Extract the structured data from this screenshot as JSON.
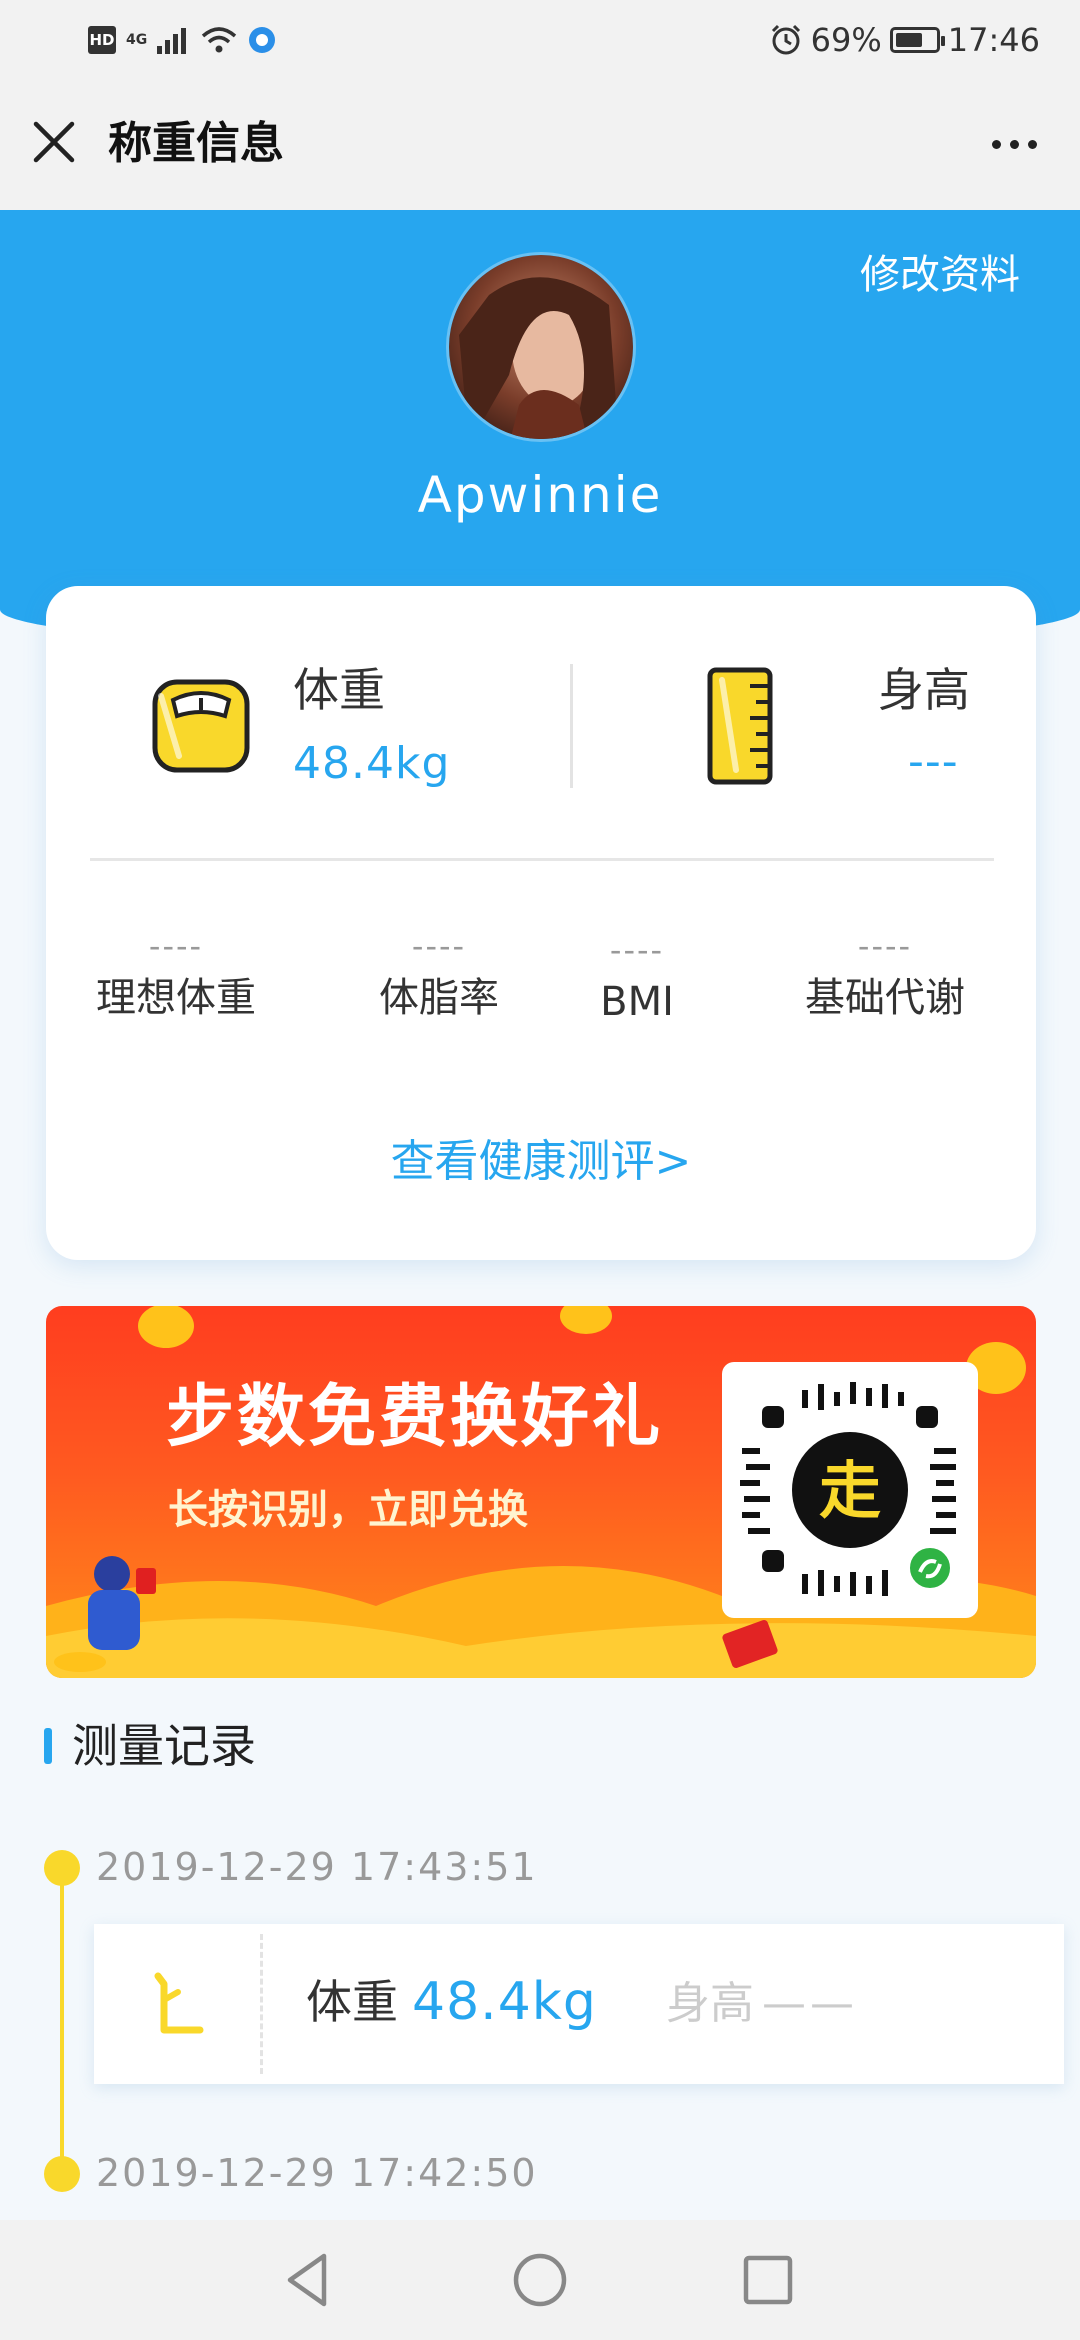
{
  "status_bar": {
    "network": "4G",
    "battery": "69%",
    "time": "17:46",
    "battery_level": 0.69
  },
  "header": {
    "title": "称重信息"
  },
  "profile": {
    "edit_label": "修改资料",
    "username": "Ap​winnie"
  },
  "summary": {
    "weight_label": "体重",
    "weight_value": "48.4kg",
    "height_label": "身高",
    "height_value": "---",
    "stats": [
      {
        "value": "----",
        "label": "理想体重"
      },
      {
        "value": "----",
        "label": "体脂率"
      },
      {
        "value": "----",
        "label": "BMI"
      },
      {
        "value": "----",
        "label": "基础代谢"
      }
    ],
    "health_link": "查看健康测评>"
  },
  "banner": {
    "title": "步数免费换好礼",
    "subtitle": "长按识别，立即兑换",
    "qr_center_char": "走"
  },
  "records": {
    "section_title": "测量记录",
    "items": [
      {
        "time": "2019-12-29 17:43:51",
        "weight_label": "体重",
        "weight_value": "48.4kg",
        "height_label": "身高",
        "height_value": "——"
      },
      {
        "time": "2019-12-29 17:42:50"
      }
    ]
  },
  "colors": {
    "accent": "#27a6ef",
    "timeline": "#f9d82b",
    "banner_red": "#ff3d1f"
  }
}
